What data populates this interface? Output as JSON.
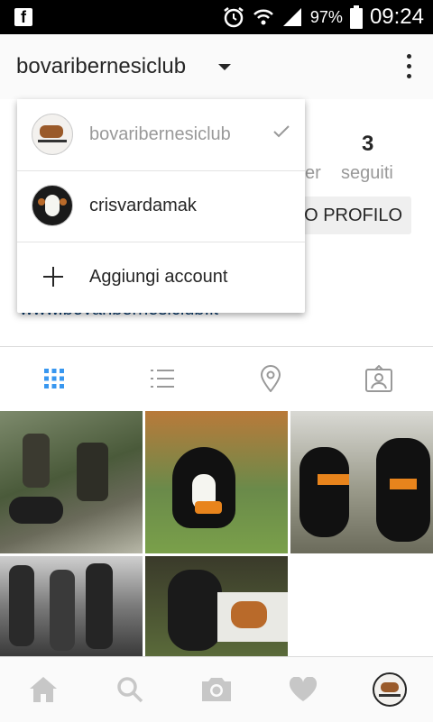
{
  "status_bar": {
    "left_icon": "facebook-notification-icon",
    "icons": [
      "alarm-icon",
      "wifi-icon",
      "signal-icon",
      "battery-icon"
    ],
    "battery_percent": "97%",
    "time": "09:24"
  },
  "header": {
    "account_name": "bovaribernesiclub",
    "dropdown_icon": "caret-down-icon",
    "menu_icon": "more-vert-icon"
  },
  "profile": {
    "following_count": "3",
    "following_label": "seguiti",
    "followers_label_partial": "er",
    "edit_button_partial": "JO PROFILO",
    "website_partial": "www.bovaribernesiclub.it"
  },
  "tabs": [
    {
      "name": "grid",
      "icon": "grid-icon",
      "active": true
    },
    {
      "name": "list",
      "icon": "list-icon",
      "active": false
    },
    {
      "name": "map",
      "icon": "location-pin-icon",
      "active": false
    },
    {
      "name": "tagged",
      "icon": "tagged-person-icon",
      "active": false
    }
  ],
  "account_switcher": {
    "items": [
      {
        "username": "bovaribernesiclub",
        "selected": true,
        "check_icon": "check-icon"
      },
      {
        "username": "crisvardamak",
        "selected": false
      },
      {
        "label": "Aggiungi account",
        "icon": "plus-icon"
      }
    ]
  },
  "photos": {
    "count": 5
  },
  "bottom_nav": [
    "home-icon",
    "search-icon",
    "camera-icon",
    "heart-icon",
    "profile-avatar-icon"
  ],
  "colors": {
    "accent": "#3897f0",
    "text": "#262626",
    "muted": "#999999",
    "status_bar": "#000000",
    "link": "#003569"
  }
}
